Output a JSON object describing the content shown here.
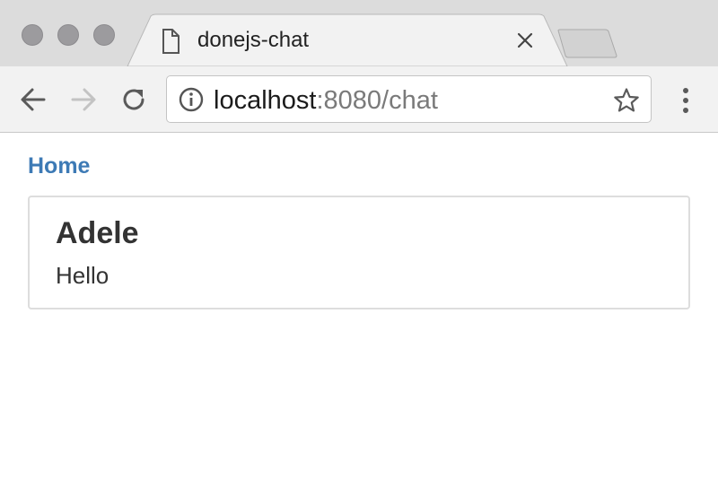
{
  "browser": {
    "tab": {
      "title": "donejs-chat",
      "icon": "file-icon",
      "close_icon": "close-icon"
    },
    "address_bar": {
      "host": "localhost",
      "rest": ":8080/chat",
      "info_icon": "info-icon",
      "bookmark_icon": "star-icon"
    },
    "nav": {
      "back_icon": "arrow-left-icon",
      "forward_icon": "arrow-right-icon",
      "reload_icon": "reload-icon",
      "menu_icon": "vertical-dots-icon"
    }
  },
  "page": {
    "home_link": "Home",
    "messages": [
      {
        "name": "Adele",
        "body": "Hello"
      }
    ]
  },
  "colors": {
    "link": "#3d7ab5",
    "titlebar": "#dcdcdc",
    "toolbar": "#f2f2f2"
  }
}
